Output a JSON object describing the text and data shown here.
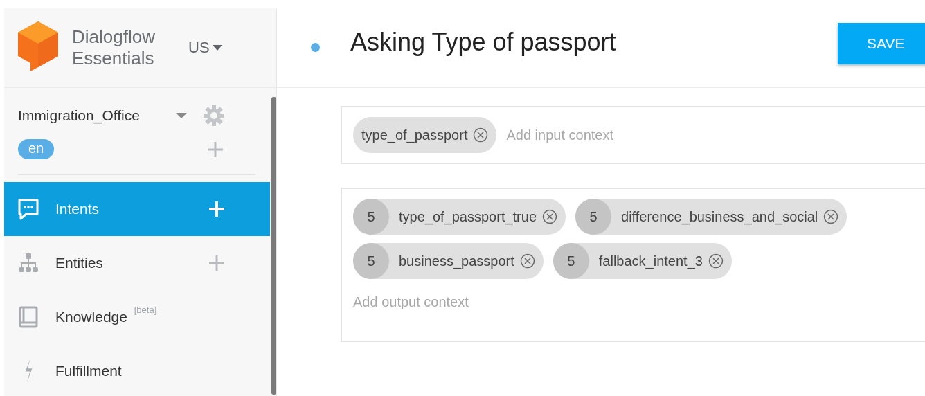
{
  "brand": {
    "line1": "Dialogflow",
    "line2": "Essentials",
    "region": "US"
  },
  "agent": {
    "name": "Immigration_Office",
    "language": "en"
  },
  "nav": [
    {
      "label": "Intents",
      "selected": true,
      "has_add": true
    },
    {
      "label": "Entities",
      "selected": false,
      "has_add": true
    },
    {
      "label": "Knowledge $^{[beta]}$",
      "selected": false,
      "has_add": false
    },
    {
      "label": "Fulfillment",
      "selected": false,
      "has_add": false
    }
  ],
  "intent": {
    "title": "Asking Type of passport",
    "save": "SAVE"
  },
  "input_contexts": {
    "chips": [
      "type_of_passport"
    ],
    "placeholder": "Add input context"
  },
  "output_contexts": {
    "chips": [
      {
        "lifespan": "5",
        "name": "type_of_passport_true"
      },
      {
        "lifespan": "5",
        "name": "difference_business_and_social"
      },
      {
        "lifespan": "5",
        "name": "business_passport"
      },
      {
        "lifespan": "5",
        "name": "fallback_intent_3"
      }
    ],
    "placeholder": "Add output context"
  }
}
